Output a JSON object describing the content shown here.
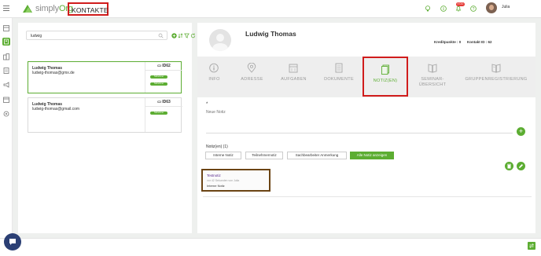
{
  "header": {
    "logo_text_prefix": "simply",
    "logo_text_suffix": "Org",
    "module_title": "KONTAKTE",
    "notification_count": "9720",
    "user_name": "Julia",
    "accent_color": "#5cad32"
  },
  "sidebar": {
    "icons": [
      "menu-icon",
      "dashboard-icon",
      "contacts-icon",
      "buildings-icon",
      "list-icon",
      "megaphone-icon",
      "calendar-icon",
      "settings-icon"
    ],
    "active_index": 1
  },
  "search": {
    "value": "ludwig",
    "tools": [
      "add-icon",
      "sort-icon",
      "filter-icon",
      "refresh-icon"
    ]
  },
  "contacts": [
    {
      "name": "Ludwig Thomas",
      "email": "ludwig-thomas@gmx.de",
      "id_label": "ID62",
      "tags": [
        "Teilnehmer",
        "Teilnehmer"
      ],
      "selected": true
    },
    {
      "name": "Ludwig Thomas",
      "email": "ludwig-thomas@gmail.com",
      "id_label": "ID63",
      "tags": [
        "Teilnehmer"
      ],
      "selected": false
    }
  ],
  "detail": {
    "name": "Ludwig Thomas",
    "credits": "Kreditpunkte : 0",
    "contact_id": "Kontakt ID : 62"
  },
  "tabs": [
    {
      "label": "INFO",
      "icon": "info-icon"
    },
    {
      "label": "ADRESSE",
      "icon": "location-icon"
    },
    {
      "label": "AUFGABEN",
      "icon": "calendar-icon"
    },
    {
      "label": "DOKUMENTE",
      "icon": "document-icon"
    },
    {
      "label": "NOTIZ(EN)",
      "icon": "notes-icon",
      "active": true
    },
    {
      "label": "SEMINAR-\nÜBERSICHT",
      "icon": "book-icon"
    },
    {
      "label": "GRUPPENREGISTRIERUNG",
      "icon": "group-book-icon"
    }
  ],
  "notes": {
    "required_marker": "*",
    "new_note_placeholder": "Neue Notiz",
    "count_label": "Notiz(en) (1)",
    "filters": [
      "Interne Notiz",
      "Teilnehmernotiz",
      "Sachbearbeiter Anmerkung",
      "Alle Notiz anzeigen"
    ],
    "items": [
      {
        "title": "Testnotiz",
        "meta": "vor 42 Sekunden von Julia",
        "type": "Interne Notiz"
      }
    ]
  }
}
